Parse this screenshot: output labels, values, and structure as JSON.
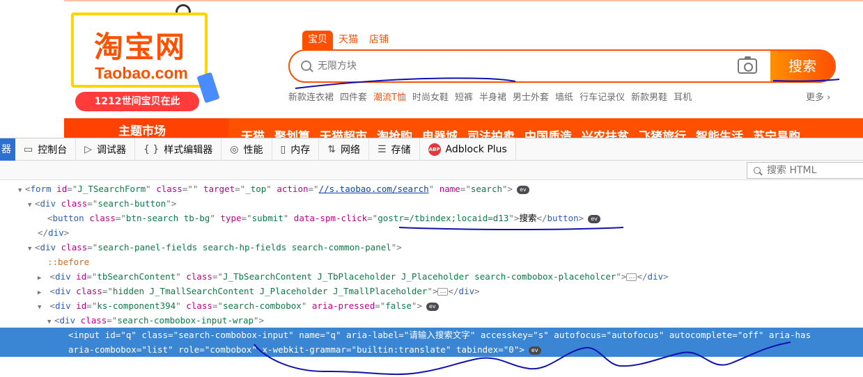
{
  "taobao": {
    "logo": {
      "name_cn": "淘宝网",
      "name_en": "Taobao.com",
      "promo": "1212世间宝贝在此"
    },
    "tabs": [
      {
        "label": "宝贝",
        "active": true
      },
      {
        "label": "天猫",
        "active": false
      },
      {
        "label": "店铺",
        "active": false
      }
    ],
    "search": {
      "placeholder": "无限方块",
      "button_label": "搜索"
    },
    "hot_words": [
      "新款连衣裙",
      "四件套",
      "潮流T恤",
      "时尚女鞋",
      "短裤",
      "半身裙",
      "男士外套",
      "墙纸",
      "行车记录仪",
      "新款男鞋",
      "耳机"
    ],
    "hot_word_highlight": "潮流T恤",
    "more_label": "更多 ›",
    "theme_market": "主题市场",
    "nav_items": [
      "天猫",
      "聚划算",
      "天猫超市",
      "淘抢购",
      "电器城",
      "司法拍卖",
      "中国质造",
      "兴农扶贫",
      "飞猪旅行",
      "智能生活",
      "苏宁易购"
    ],
    "accent_color": "#ff5000"
  },
  "devtools": {
    "edge_tab_label": "器",
    "tabs": [
      {
        "icon": "console-icon",
        "glyph": "▭",
        "label": "控制台"
      },
      {
        "icon": "debugger-icon",
        "glyph": "▷",
        "label": "调试器"
      },
      {
        "icon": "style-editor-icon",
        "glyph": "{ }",
        "label": "样式编辑器"
      },
      {
        "icon": "performance-icon",
        "glyph": "◎",
        "label": "性能"
      },
      {
        "icon": "memory-icon",
        "glyph": "▯",
        "label": "内存"
      },
      {
        "icon": "network-icon",
        "glyph": "⇅",
        "label": "网络"
      },
      {
        "icon": "storage-icon",
        "glyph": "☰",
        "label": "存储"
      },
      {
        "icon": "adblock-icon",
        "glyph": "ABP",
        "label": "Adblock Plus"
      }
    ],
    "html_search_placeholder": "搜索 HTML",
    "selected_color": "#3a86d4"
  },
  "dom": {
    "l1": {
      "tag": "form",
      "a1": "id",
      "v1": "J_TSearchForm",
      "a2": "class",
      "v2": "",
      "a3": "target",
      "v3": "_top",
      "a4": "action",
      "v4": "//s.taobao.com/search",
      "a5": "name",
      "v5": "search",
      "badge": "ev"
    },
    "l2": {
      "tag": "div",
      "a1": "class",
      "v1": "search-button"
    },
    "l3": {
      "tag": "button",
      "a1": "class",
      "v1": "btn-search tb-bg",
      "a2": "type",
      "v2": "submit",
      "a3": "data-spm-click",
      "v3": "gostr=/tbindex;locaid=d13",
      "text": "搜索",
      "badge": "ev"
    },
    "l4": {
      "close": "div"
    },
    "l5": {
      "tag": "div",
      "a1": "class",
      "v1": "search-panel-fields search-hp-fields search-common-panel"
    },
    "l6": {
      "pseudo": "::before"
    },
    "l7": {
      "tag": "div",
      "a1": "id",
      "v1": "tbSearchContent",
      "a2": "class",
      "v2": "J_TbSearchContent J_TbPlaceholder J_Placeholder search-combobox-placeholcer",
      "ellipsis": "…"
    },
    "l8": {
      "tag": "div",
      "a1": "class",
      "v1": "hidden J_TmallSearchContent J_Placeholder J_TmallPlaceholder",
      "ellipsis": "…"
    },
    "l9": {
      "tag": "div",
      "a1": "id",
      "v1": "ks-component394",
      "a2": "class",
      "v2": "search-combobox",
      "a3": "aria-pressed",
      "v3": "false",
      "badge": "ev"
    },
    "l10": {
      "tag": "div",
      "a1": "class",
      "v1": "search-combobox-input-wrap"
    },
    "l11": {
      "tag": "input",
      "a1": "id",
      "v1": "q",
      "a2": "class",
      "v2": "search-combobox-input",
      "a3": "name",
      "v3": "q",
      "a4": "aria-label",
      "v4": "请输入搜索文字",
      "a5": "accesskey",
      "v5": "s",
      "a6": "autofocus",
      "v6": "autofocus",
      "a7": "autocomplete",
      "v7": "off",
      "a8": "aria-has"
    },
    "l12": {
      "a1": "aria-combobox",
      "v1": "list",
      "a2": "role",
      "v2": "combobox",
      "a3": "x-webkit-grammar",
      "v3": "builtin:translate",
      "a4": "tabindex",
      "v4": "0",
      "badge": "ev"
    }
  },
  "annotations": {
    "pen_color": "#1010b0"
  }
}
